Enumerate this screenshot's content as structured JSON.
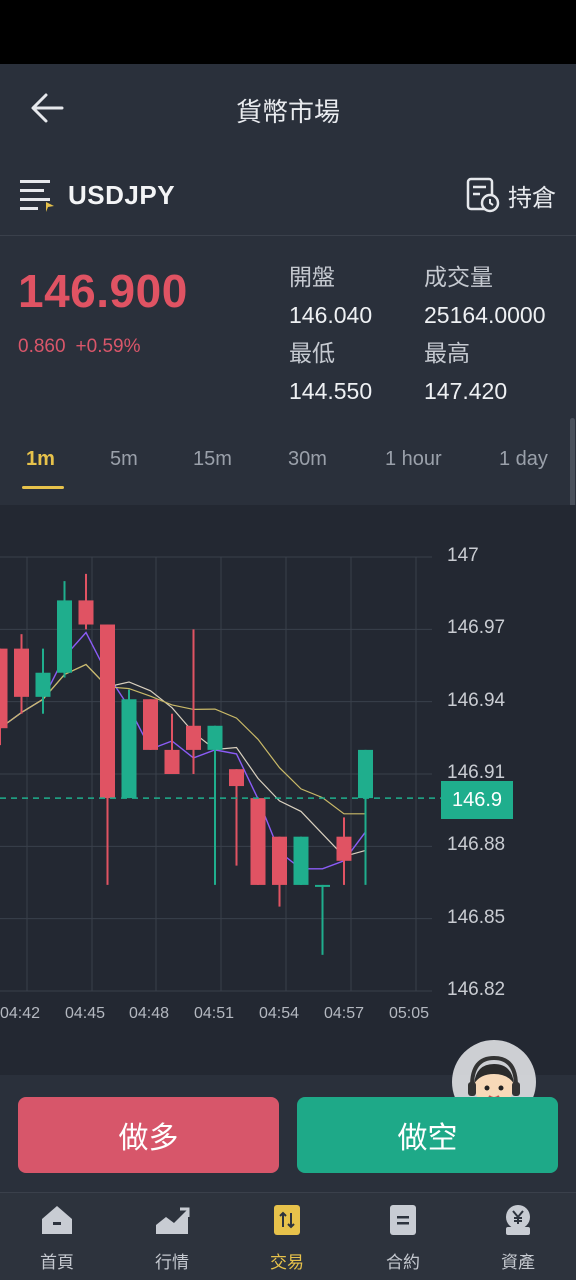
{
  "header": {
    "title": "貨幣市場"
  },
  "symbol": {
    "name": "USDJPY",
    "holdings_label": "持倉"
  },
  "quote": {
    "price": "146.900",
    "change": "0.860",
    "change_pct": "+0.59%",
    "open_label": "開盤",
    "open": "146.040",
    "volume_label": "成交量",
    "volume": "25164.0000",
    "low_label": "最低",
    "low": "144.550",
    "high_label": "最高",
    "high": "147.420"
  },
  "timeframes": [
    "1m",
    "5m",
    "15m",
    "30m",
    "1 hour",
    "1 day"
  ],
  "active_timeframe": "1m",
  "chart_data": {
    "type": "candlestick",
    "y_ticks": [
      "147",
      "146.97",
      "146.94",
      "146.91",
      "146.88",
      "146.85",
      "146.82"
    ],
    "ylim": [
      146.82,
      147.0
    ],
    "x_ticks": [
      "04:42",
      "04:45",
      "04:48",
      "04:51",
      "04:54",
      "04:57",
      "05:05"
    ],
    "current_price_tag": "146.9",
    "candles": [
      {
        "o": 146.962,
        "h": 146.962,
        "l": 146.922,
        "c": 146.929
      },
      {
        "o": 146.962,
        "h": 146.968,
        "l": 146.935,
        "c": 146.942
      },
      {
        "o": 146.942,
        "h": 146.962,
        "l": 146.935,
        "c": 146.952
      },
      {
        "o": 146.952,
        "h": 146.99,
        "l": 146.95,
        "c": 146.982
      },
      {
        "o": 146.982,
        "h": 146.993,
        "l": 146.97,
        "c": 146.972
      },
      {
        "o": 146.972,
        "h": 146.972,
        "l": 146.864,
        "c": 146.9
      },
      {
        "o": 146.9,
        "h": 146.945,
        "l": 146.9,
        "c": 146.941
      },
      {
        "o": 146.941,
        "h": 146.941,
        "l": 146.92,
        "c": 146.92
      },
      {
        "o": 146.92,
        "h": 146.935,
        "l": 146.91,
        "c": 146.91
      },
      {
        "o": 146.93,
        "h": 146.97,
        "l": 146.91,
        "c": 146.92
      },
      {
        "o": 146.92,
        "h": 146.93,
        "l": 146.864,
        "c": 146.93
      },
      {
        "o": 146.912,
        "h": 146.912,
        "l": 146.872,
        "c": 146.905
      },
      {
        "o": 146.9,
        "h": 146.9,
        "l": 146.864,
        "c": 146.864
      },
      {
        "o": 146.884,
        "h": 146.884,
        "l": 146.855,
        "c": 146.864
      },
      {
        "o": 146.864,
        "h": 146.884,
        "l": 146.864,
        "c": 146.884
      },
      {
        "o": 146.864,
        "h": 146.864,
        "l": 146.835,
        "c": 146.864
      },
      {
        "o": 146.884,
        "h": 146.892,
        "l": 146.864,
        "c": 146.874
      },
      {
        "o": 146.9,
        "h": 146.92,
        "l": 146.864,
        "c": 146.92
      }
    ]
  },
  "actions": {
    "long_label": "做多",
    "short_label": "做空"
  },
  "bottom_nav": [
    {
      "label": "首頁",
      "icon": "home-icon"
    },
    {
      "label": "行情",
      "icon": "market-icon"
    },
    {
      "label": "交易",
      "icon": "trade-icon"
    },
    {
      "label": "合約",
      "icon": "contract-icon"
    },
    {
      "label": "資產",
      "icon": "assets-icon"
    }
  ],
  "active_nav": "交易",
  "colors": {
    "up": "#1fae8d",
    "down": "#e05363",
    "accent": "#e7c24b"
  }
}
